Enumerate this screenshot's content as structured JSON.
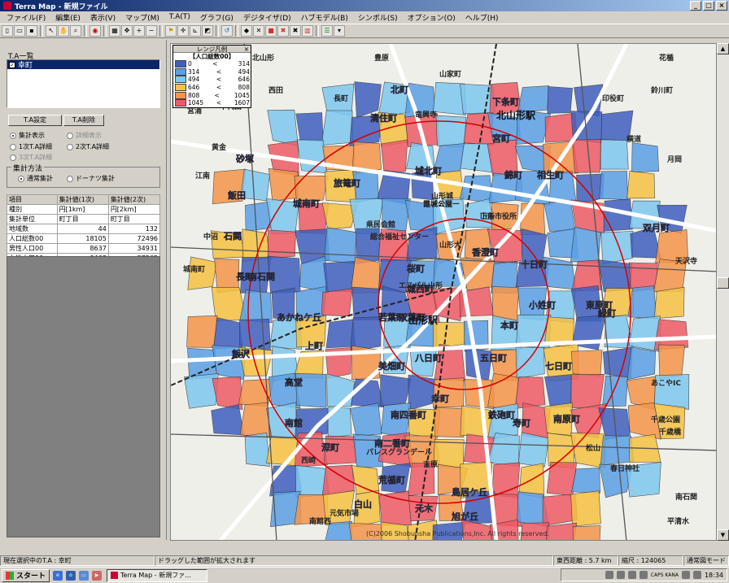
{
  "window": {
    "title": "Terra Map - 新規ファイル",
    "controls": [
      "_",
      "□",
      "×"
    ]
  },
  "menu": [
    "ファイル(F)",
    "編集(E)",
    "表示(V)",
    "マップ(M)",
    "T.A(T)",
    "グラフ(G)",
    "デジタイザ(D)",
    "ハブモデル(B)",
    "シンボル(S)",
    "オプション(O)",
    "ヘルプ(H)"
  ],
  "left_panel": {
    "ta_list_label": "T.A一覧",
    "ta_list_items": [
      {
        "label": "幸町",
        "checked": true
      }
    ],
    "ta_set_button": "T.A設定",
    "ta_delete_button": "T.A削除",
    "display_options": {
      "aggregate_display": "集計表示",
      "detail_display": "詳細表示",
      "primary_detail": "1次T.A詳細",
      "secondary_detail": "2次T.A詳細",
      "tertiary_detail": "3次T.A詳細"
    },
    "aggregation_method_label": "集計方法",
    "aggregation_normal": "通常集計",
    "aggregation_donut": "ドーナツ集計",
    "table": {
      "headers": [
        "項目",
        "集計値(1次)",
        "集計値(2次)"
      ],
      "rows": [
        [
          "種別",
          "円[1km]",
          "円[2km]"
        ],
        [
          "集計単位",
          "町丁目",
          "町丁目"
        ],
        [
          "地域数",
          "44",
          "132"
        ],
        [
          "人口総数00",
          "18105",
          "72496"
        ],
        [
          "男性人口00",
          "8637",
          "34931"
        ],
        [
          "女性人口00",
          "9468",
          "37565"
        ]
      ]
    }
  },
  "legend": {
    "title": "レンジ凡例",
    "subtitle": "【人口総数00】",
    "close": "×",
    "rows": [
      {
        "color": "#3f5fbf",
        "min": "0",
        "op": "<",
        "max": "314"
      },
      {
        "color": "#5aa0e6",
        "min": "314",
        "op": "<",
        "max": "494"
      },
      {
        "color": "#7fc8f0",
        "min": "494",
        "op": "<",
        "max": "646"
      },
      {
        "color": "#f5c242",
        "min": "646",
        "op": "<",
        "max": "808"
      },
      {
        "color": "#f5954a",
        "min": "808",
        "op": "<",
        "max": "1045"
      },
      {
        "color": "#ee5a66",
        "min": "1045",
        "op": "<",
        "max": "1607"
      }
    ]
  },
  "map_labels": {
    "stations": [
      "北山形駅",
      "山形駅"
    ],
    "districts": [
      "下条町",
      "城西町",
      "清住町",
      "旅篭町",
      "城南町",
      "桜町",
      "双葉町",
      "香澄町",
      "若葉町",
      "八日町",
      "幸町",
      "五日町",
      "美畑町",
      "南四番町",
      "南二番町",
      "荒楯町",
      "鳥居ケ丘",
      "旭が丘",
      "あかねケ丘",
      "飯沢",
      "高堂",
      "砂塚",
      "飯田",
      "北町",
      "双月町",
      "東原町",
      "鉄砲町",
      "寿町",
      "南原町",
      "七日町",
      "本町",
      "小姓町",
      "緑町",
      "宮町",
      "錦町",
      "相生町",
      "南館",
      "深町",
      "白山",
      "元木",
      "上町",
      "石関",
      "南石関",
      "長町",
      "十日町",
      "城北町"
    ],
    "places": [
      "山形市役所",
      "霞城公園",
      "県民会館",
      "総合福祉センター",
      "山形大",
      "山形城",
      "エスパル山形",
      "元気市場",
      "パレスグランデール",
      "北山形",
      "あこやIC",
      "千歳公園",
      "千歳橋",
      "松山",
      "春日神社",
      "花楯",
      "鈴川町",
      "印役町",
      "長町",
      "西田",
      "豊原",
      "江南",
      "宮浦",
      "千代田",
      "黄金",
      "西崎",
      "南館西",
      "吉原",
      "城南町",
      "中沼",
      "横道",
      "月岡",
      "平清水",
      "南石関",
      "天沢寺",
      "竜興寺",
      "山家町",
      "下条",
      "ファミリー"
    ],
    "copyright": "(C)2006 Shobunsha Publications,Inc. All rights reserved."
  },
  "status": {
    "current_ta": "現在選択中のT.A : 幸町",
    "hint": "ドラッグした範囲が拡大されます",
    "ew_distance": "東西距離 : 5.7 km",
    "scale": "縮尺 : 124065",
    "mode": "通常図モード"
  },
  "taskbar": {
    "start": "スタート",
    "task_item": "Terra Map - 新規ファ...",
    "tray_caps": "CAPS KANA",
    "clock": "18:34"
  }
}
